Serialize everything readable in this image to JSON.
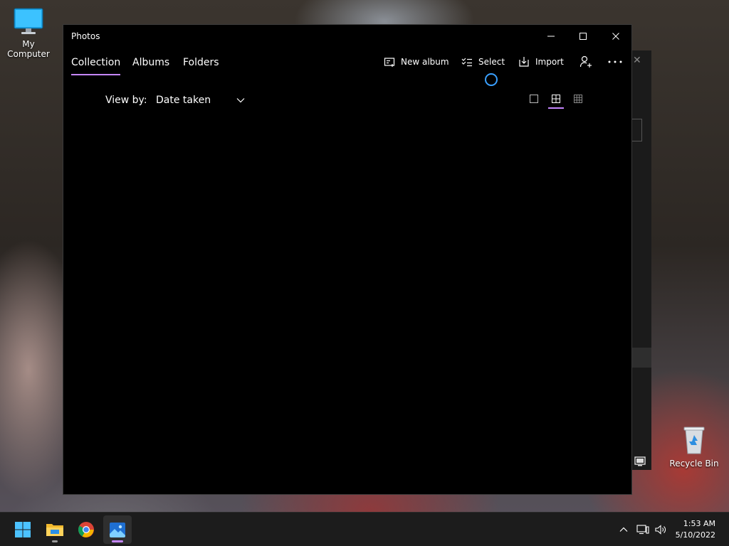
{
  "desktop": {
    "icons": [
      {
        "label": "My Computer"
      },
      {
        "label": "Recycle Bin"
      }
    ]
  },
  "window": {
    "title": "Photos",
    "nav_tabs": [
      {
        "label": "Collection",
        "active": true
      },
      {
        "label": "Albums",
        "active": false
      },
      {
        "label": "Folders",
        "active": false
      }
    ],
    "toolbar": {
      "new_album": "New album",
      "select": "Select",
      "import": "Import"
    },
    "view_by": {
      "label": "View by:",
      "value": "Date taken"
    },
    "view_modes": [
      "single-square-icon",
      "medium-grid-icon",
      "small-grid-icon"
    ],
    "active_view_mode": "medium-grid-icon"
  },
  "taskbar": {
    "apps": [
      "start-icon",
      "file-explorer-icon",
      "chrome-icon",
      "photos-icon"
    ],
    "active_app": "photos-icon",
    "clock": {
      "time": "1:53 AM",
      "date": "5/10/2022"
    }
  },
  "colors": {
    "accent": "#c586ff",
    "spinner": "#3aa0ff",
    "window_bg": "#000000",
    "taskbar_bg": "#1c1c1c"
  }
}
